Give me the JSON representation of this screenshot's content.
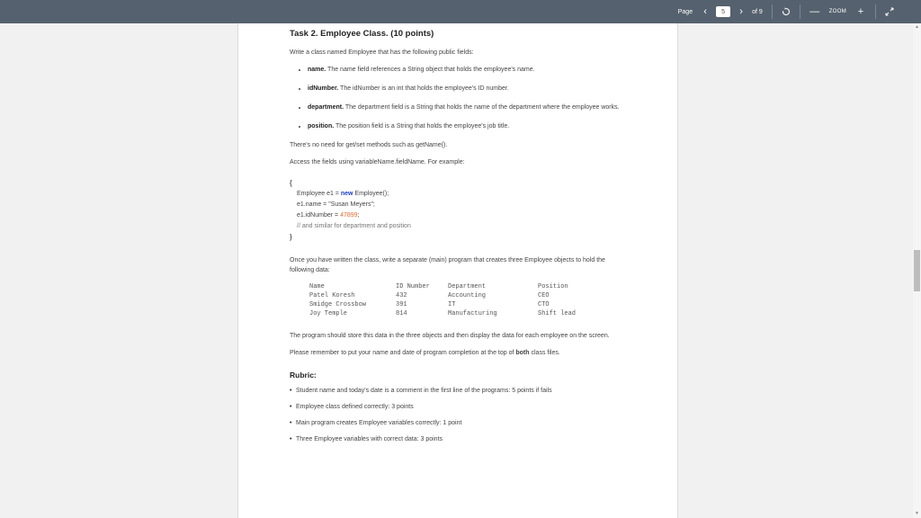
{
  "toolbar": {
    "page_label": "Page",
    "current_page": "5",
    "total_pages": "of 9",
    "zoom_label": "ZOOM",
    "zoom_out": "—",
    "zoom_in": "+"
  },
  "document": {
    "task_title": "Task 2.  Employee Class. (10 points)",
    "intro": "Write a class named Employee that has the following public fields:",
    "fields": [
      {
        "name": "name.",
        "desc": " The name field references a String object that holds the employee's name."
      },
      {
        "name": "idNumber.",
        "desc": " The idNumber is an int that holds the employee's ID number."
      },
      {
        "name": "department.",
        "desc": " The department field is a String that holds the name of the department where the employee works."
      },
      {
        "name": "position.",
        "desc": " The position field is a String that holds the employee's job title."
      }
    ],
    "no_getset": "There's no need for get/set methods such as getName().",
    "access_note": "Access the fields using variableName.fieldName. For example:",
    "code": {
      "open_brace": "{",
      "line1_a": "Employee e1 = ",
      "line1_kw": "new",
      "line1_b": " Employee();",
      "line2": "e1.name = \"Susan Meyers\";",
      "line3_a": "e1.idNumber = ",
      "line3_num": "47899",
      "line3_b": ";",
      "line4": "// and similar for department and position",
      "close_brace": "}"
    },
    "once_text": "Once you have written the class, write a separate (main) program that creates three Employee objects to hold the following data:",
    "table": {
      "headers": [
        "Name",
        "ID Number",
        "Department",
        "Position"
      ],
      "rows": [
        [
          "Patel Koresh",
          "432",
          "Accounting",
          "CEO"
        ],
        [
          "Smidge Crossbow",
          "391",
          "IT",
          "CTO"
        ],
        [
          "Joy Temple",
          "814",
          "Manufacturing",
          "Shift lead"
        ]
      ]
    },
    "store_text": "The program should store this data in the three objects and then display the data for each employee on the screen.",
    "remember_a": "Please remember to put your name and date of program completion at the top of ",
    "remember_b": "both",
    "remember_c": " class files.",
    "rubric_title": "Rubric:",
    "rubric": [
      "Student name and today's date is a comment in the first line of the programs:  5 points if fails",
      "Employee class defined correctly: 3 points",
      "Main program creates Employee variables correctly: 1 point",
      "Three Employee variables with correct data: 3 points"
    ]
  },
  "icons": {
    "prev": "chevron-left-icon",
    "next": "chevron-right-icon",
    "rotate": "rotate-icon",
    "fullscreen": "fullscreen-icon"
  }
}
